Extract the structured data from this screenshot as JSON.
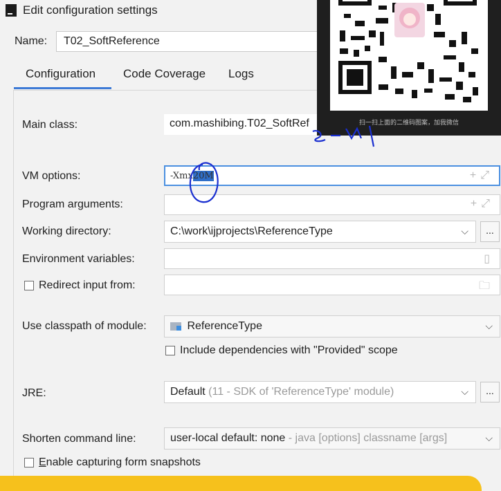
{
  "window": {
    "title": "Edit configuration settings"
  },
  "name": {
    "label": "Name:",
    "value": "T02_SoftReference"
  },
  "tabs": [
    {
      "label": "Configuration"
    },
    {
      "label": "Code Coverage"
    },
    {
      "label": "Logs"
    }
  ],
  "form": {
    "main_class": {
      "label": "Main class:",
      "value": "com.mashibing.T02_SoftRef"
    },
    "vm_options": {
      "label": "VM options:",
      "value_prefix": "-Xmx",
      "value_selected": "20M"
    },
    "program_arguments": {
      "label": "Program arguments:"
    },
    "working_directory": {
      "label": "Working directory:",
      "value": "C:\\work\\ijprojects\\ReferenceType"
    },
    "environment_variables": {
      "label": "Environment variables:"
    },
    "redirect_input": {
      "label": "Redirect input from:"
    },
    "classpath_module": {
      "label": "Use classpath of module:",
      "value": "ReferenceType"
    },
    "include_provided": {
      "label": "Include dependencies with \"Provided\" scope"
    },
    "jre": {
      "label": "JRE:",
      "value": "Default",
      "hint": "(11 - SDK of 'ReferenceType' module)"
    },
    "shorten_command_line": {
      "label": "Shorten command line:",
      "value": "user-local default: none",
      "hint": "- java [options] classname [args]"
    },
    "capture_snapshots": {
      "label_underlined": "E",
      "label_rest": "nable capturing form snapshots"
    }
  },
  "buttons": {
    "browse": "..."
  },
  "overlay": {
    "caption": "扫一扫上面的二维码图案，加我微信"
  },
  "colors": {
    "accent": "#3d7ad6",
    "selection": "#2f6ec8",
    "annotation": "#1a2fd0",
    "banner": "#f6c11c"
  }
}
